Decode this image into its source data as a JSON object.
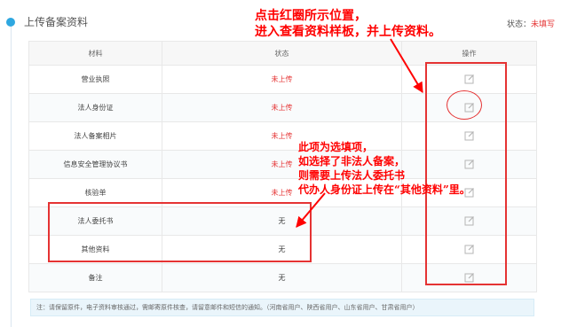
{
  "section": {
    "title": "上传备案资料"
  },
  "status": {
    "label": "状态：",
    "value": "未填写"
  },
  "annotations": {
    "top_line1": "点击红圈所示位置，",
    "top_line2": "进入查看资料样板，并上传资料。",
    "mid_line1": "此项为选填项，",
    "mid_line2": "如选择了非法人备案，",
    "mid_line3": "则需要上传法人委托书",
    "mid_line4": "代办人身份证上传在“其他资料”里。"
  },
  "table": {
    "headers": {
      "material": "材料",
      "status": "状态",
      "action": "操作"
    },
    "rows": [
      {
        "material": "营业执照",
        "status": "未上传"
      },
      {
        "material": "法人身份证",
        "status": "未上传"
      },
      {
        "material": "法人备案相片",
        "status": "未上传"
      },
      {
        "material": "信息安全管理协议书",
        "status": "未上传"
      },
      {
        "material": "核验单",
        "status": "未上传"
      },
      {
        "material": "法人委托书",
        "status": "无"
      },
      {
        "material": "其他资料",
        "status": "无"
      },
      {
        "material": "备注",
        "status": "无"
      }
    ]
  },
  "note": {
    "text": "注：请保留原件，电子资料审核通过，需邮寄原件核查，请留意邮件和短信的通知。（河南省用户、陕西省用户、山东省用户、甘肃省用户）"
  },
  "colors": {
    "accent": "#2ea7e0",
    "alert": "#e53333",
    "annotation": "#ff0000"
  },
  "icons": {
    "edit": "edit-icon",
    "section": "circle-dot-icon"
  }
}
